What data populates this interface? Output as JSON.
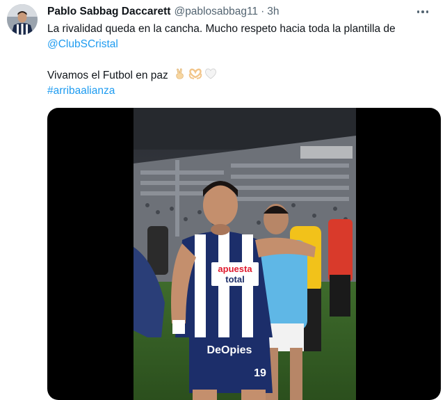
{
  "tweet": {
    "author_name": "Pablo Sabbag Daccarett",
    "handle": "@pablosabbag11",
    "separator": "·",
    "time": "3h",
    "text_line_1": "La rivalidad queda en la cancha. Mucho respeto hacia toda la plantilla de",
    "mention": "@ClubSCristal",
    "text_line_3": "Vivamos el Futbol en paz",
    "hashtag": "#arribaalianza",
    "emojis": [
      "victory-hand-icon",
      "heart-hands-icon",
      "white-heart-icon"
    ]
  },
  "video": {
    "jersey_sponsor": "apuesta total",
    "shorts_sponsor": "DeOpies",
    "shorts_number": "19"
  },
  "colors": {
    "link": "#1d9bf0",
    "secondary_text": "#536471",
    "primary_text": "#0f1419",
    "media_background": "#000000"
  }
}
